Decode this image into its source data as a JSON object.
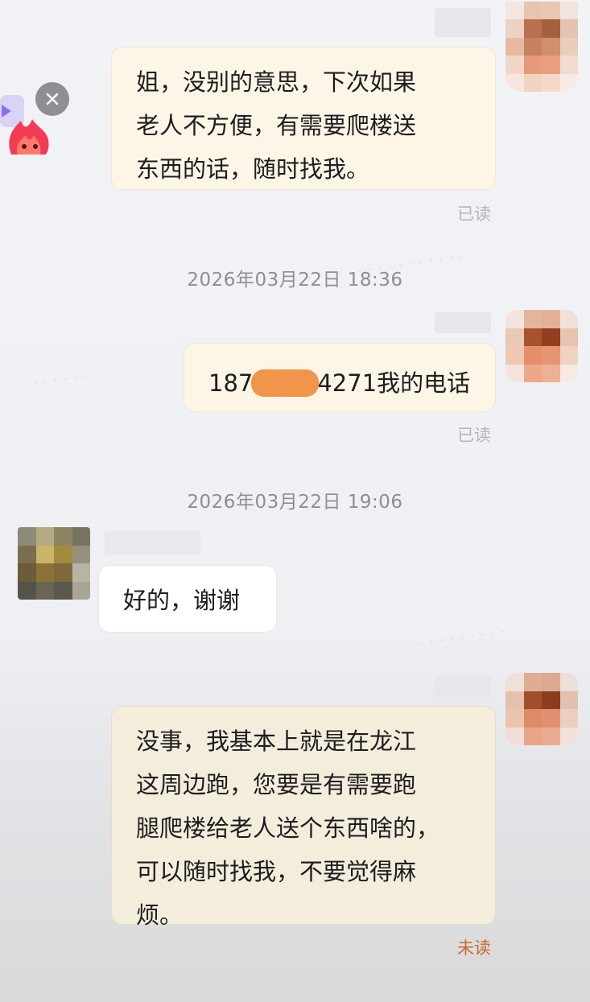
{
  "messages": [
    {
      "id": "m1",
      "side": "outgoing",
      "text": "姐，没别的意思，下次如果老人不方便，有需要爬楼送东西的话，随时找我。",
      "lines": [
        "姐，没别的意思，下次如果",
        "老人不方便，有需要爬楼送",
        "东西的话，随时找我。"
      ],
      "status": "已读"
    },
    {
      "id": "t1",
      "type": "timestamp",
      "text": "2026年03月22日 18:36"
    },
    {
      "id": "m2",
      "side": "outgoing",
      "text_start": "187",
      "text_end": "4271我的电话",
      "redacted": true,
      "status": "已读"
    },
    {
      "id": "t2",
      "type": "timestamp",
      "text": "2026年03月22日 19:06"
    },
    {
      "id": "m3",
      "side": "incoming",
      "text": "好的，谢谢"
    },
    {
      "id": "m4",
      "side": "outgoing",
      "lines": [
        "没事，我基本上就是在龙江",
        "这周边跑，您要是有需要跑",
        "腿爬楼给老人送个东西啥的，",
        "可以随时找我，不要觉得麻",
        "烦。"
      ],
      "status": "未读"
    }
  ],
  "floating_widget": {
    "close_icon": "close-icon",
    "mascot": "flame-mascot-icon"
  },
  "colors": {
    "outgoing_bubble": "#fdf6e6",
    "incoming_bubble": "#ffffff",
    "read_status": "#b4b6bc",
    "unread_status": "#c86a2c",
    "redaction": "#f0954a"
  }
}
